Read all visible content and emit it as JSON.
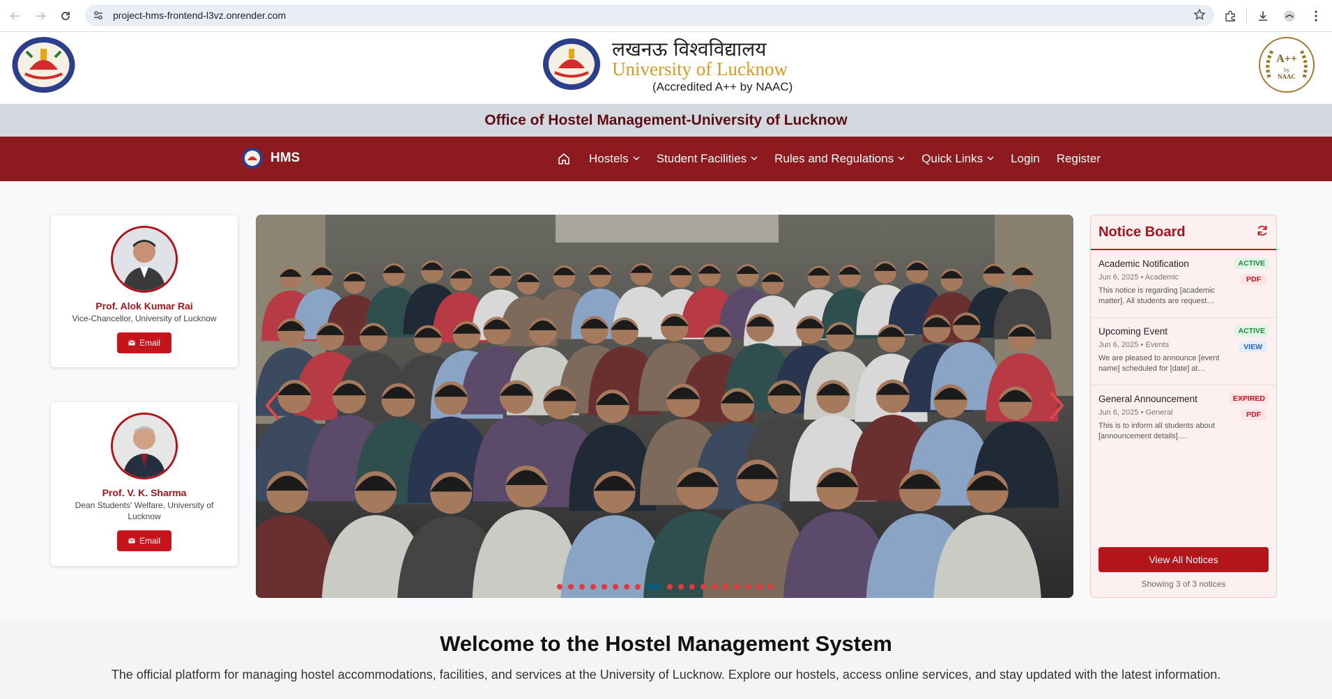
{
  "browser": {
    "url": "project-hms-frontend-l3vz.onrender.com"
  },
  "header": {
    "hindi_title": "लखनऊ विश्वविद्यालय",
    "english_title": "University of Lucknow",
    "accreditation": "(Accredited A++ by NAAC)"
  },
  "office_bar": {
    "title": "Office of Hostel Management-University of Lucknow"
  },
  "navbar": {
    "brand": "HMS",
    "items": [
      {
        "label": "Hostels"
      },
      {
        "label": "Student Facilities"
      },
      {
        "label": "Rules and Regulations"
      },
      {
        "label": "Quick Links"
      },
      {
        "label": "Login"
      },
      {
        "label": "Register"
      }
    ]
  },
  "people": [
    {
      "name": "Prof. Alok Kumar Rai",
      "role": "Vice-Chancellor, University of Lucknow",
      "button": "Email"
    },
    {
      "name": "Prof. V. K. Sharma",
      "role": "Dean Students' Welfare, University of Lucknow",
      "button": "Email"
    }
  ],
  "carousel": {
    "slide_count": 19,
    "active_index": 8
  },
  "notice_board": {
    "title": "Notice Board",
    "notices": [
      {
        "title": "Academic Notification",
        "meta": "Jun 6, 2025 • Academic",
        "desc": "This notice is regarding [academic matter]. All students are request…",
        "status": "ACTIVE",
        "action": "PDF"
      },
      {
        "title": "Upcoming Event",
        "meta": "Jun 6, 2025 • Events",
        "desc": "We are pleased to announce [event name] scheduled for [date] at…",
        "status": "ACTIVE",
        "action": "VIEW"
      },
      {
        "title": "General Announcement",
        "meta": "Jun 6, 2025 • General",
        "desc": "This is to inform all students about [announcement details].…",
        "status": "EXPIRED",
        "action": "PDF"
      }
    ],
    "view_all": "View All Notices",
    "showing": "Showing 3 of 3 notices"
  },
  "welcome": {
    "title": "Welcome to the Hostel Management System",
    "description": "The official platform for managing hostel accommodations, facilities, and services at the University of Lucknow. Explore our hostels, access online services, and stay updated with the latest information."
  },
  "colors": {
    "brand_maroon": "#8c1a1e",
    "accent_red": "#c5141b",
    "gold": "#d99a1e",
    "office_bar": "#d3d7de"
  }
}
